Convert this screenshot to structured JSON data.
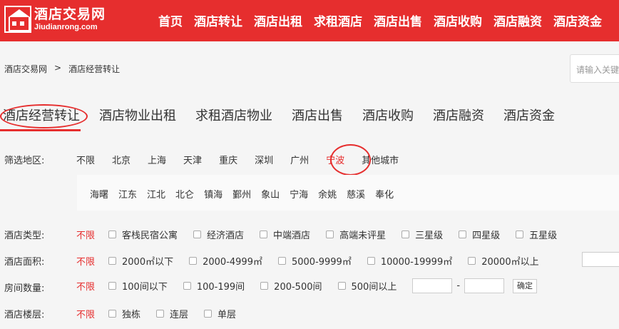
{
  "header": {
    "logo_cn": "酒店交易网",
    "logo_en": "Jiudianrong.com",
    "nav": [
      "首页",
      "酒店转让",
      "酒店出租",
      "求租酒店",
      "酒店出售",
      "酒店收购",
      "酒店融资",
      "酒店资金"
    ]
  },
  "breadcrumb": {
    "home": "酒店交易网",
    "sep": ">",
    "current": "酒店经营转让"
  },
  "search": {
    "placeholder": "请输入关键词"
  },
  "tabs": [
    "酒店经营转让",
    "酒店物业出租",
    "求租酒店物业",
    "酒店出售",
    "酒店收购",
    "酒店融资",
    "酒店资金"
  ],
  "filters": {
    "region_label": "筛选地区:",
    "cities": [
      "不限",
      "北京",
      "上海",
      "天津",
      "重庆",
      "深圳",
      "广州",
      "宁波",
      "其他城市"
    ],
    "selected_city": "宁波",
    "districts": [
      "海曙",
      "江东",
      "江北",
      "北仑",
      "镇海",
      "鄞州",
      "象山",
      "宁海",
      "余姚",
      "慈溪",
      "奉化"
    ],
    "no_limit": "不限",
    "type_label": "酒店类型:",
    "types": [
      "客栈民宿公寓",
      "经济酒店",
      "中端酒店",
      "高端未评星",
      "三星级",
      "四星级",
      "五星级"
    ],
    "area_label": "酒店面积:",
    "areas": [
      "2000㎡以下",
      "2000-4999㎡",
      "5000-9999㎡",
      "10000-19999㎡",
      "20000㎡以上"
    ],
    "rooms_label": "房间数量:",
    "rooms": [
      "100间以下",
      "100-199间",
      "200-500间",
      "500间以上"
    ],
    "range_dash": "-",
    "confirm": "确定",
    "floor_label": "酒店楼层:",
    "floors": [
      "独栋",
      "连层",
      "单层"
    ]
  },
  "colors": {
    "brand": "#e62e2e"
  }
}
